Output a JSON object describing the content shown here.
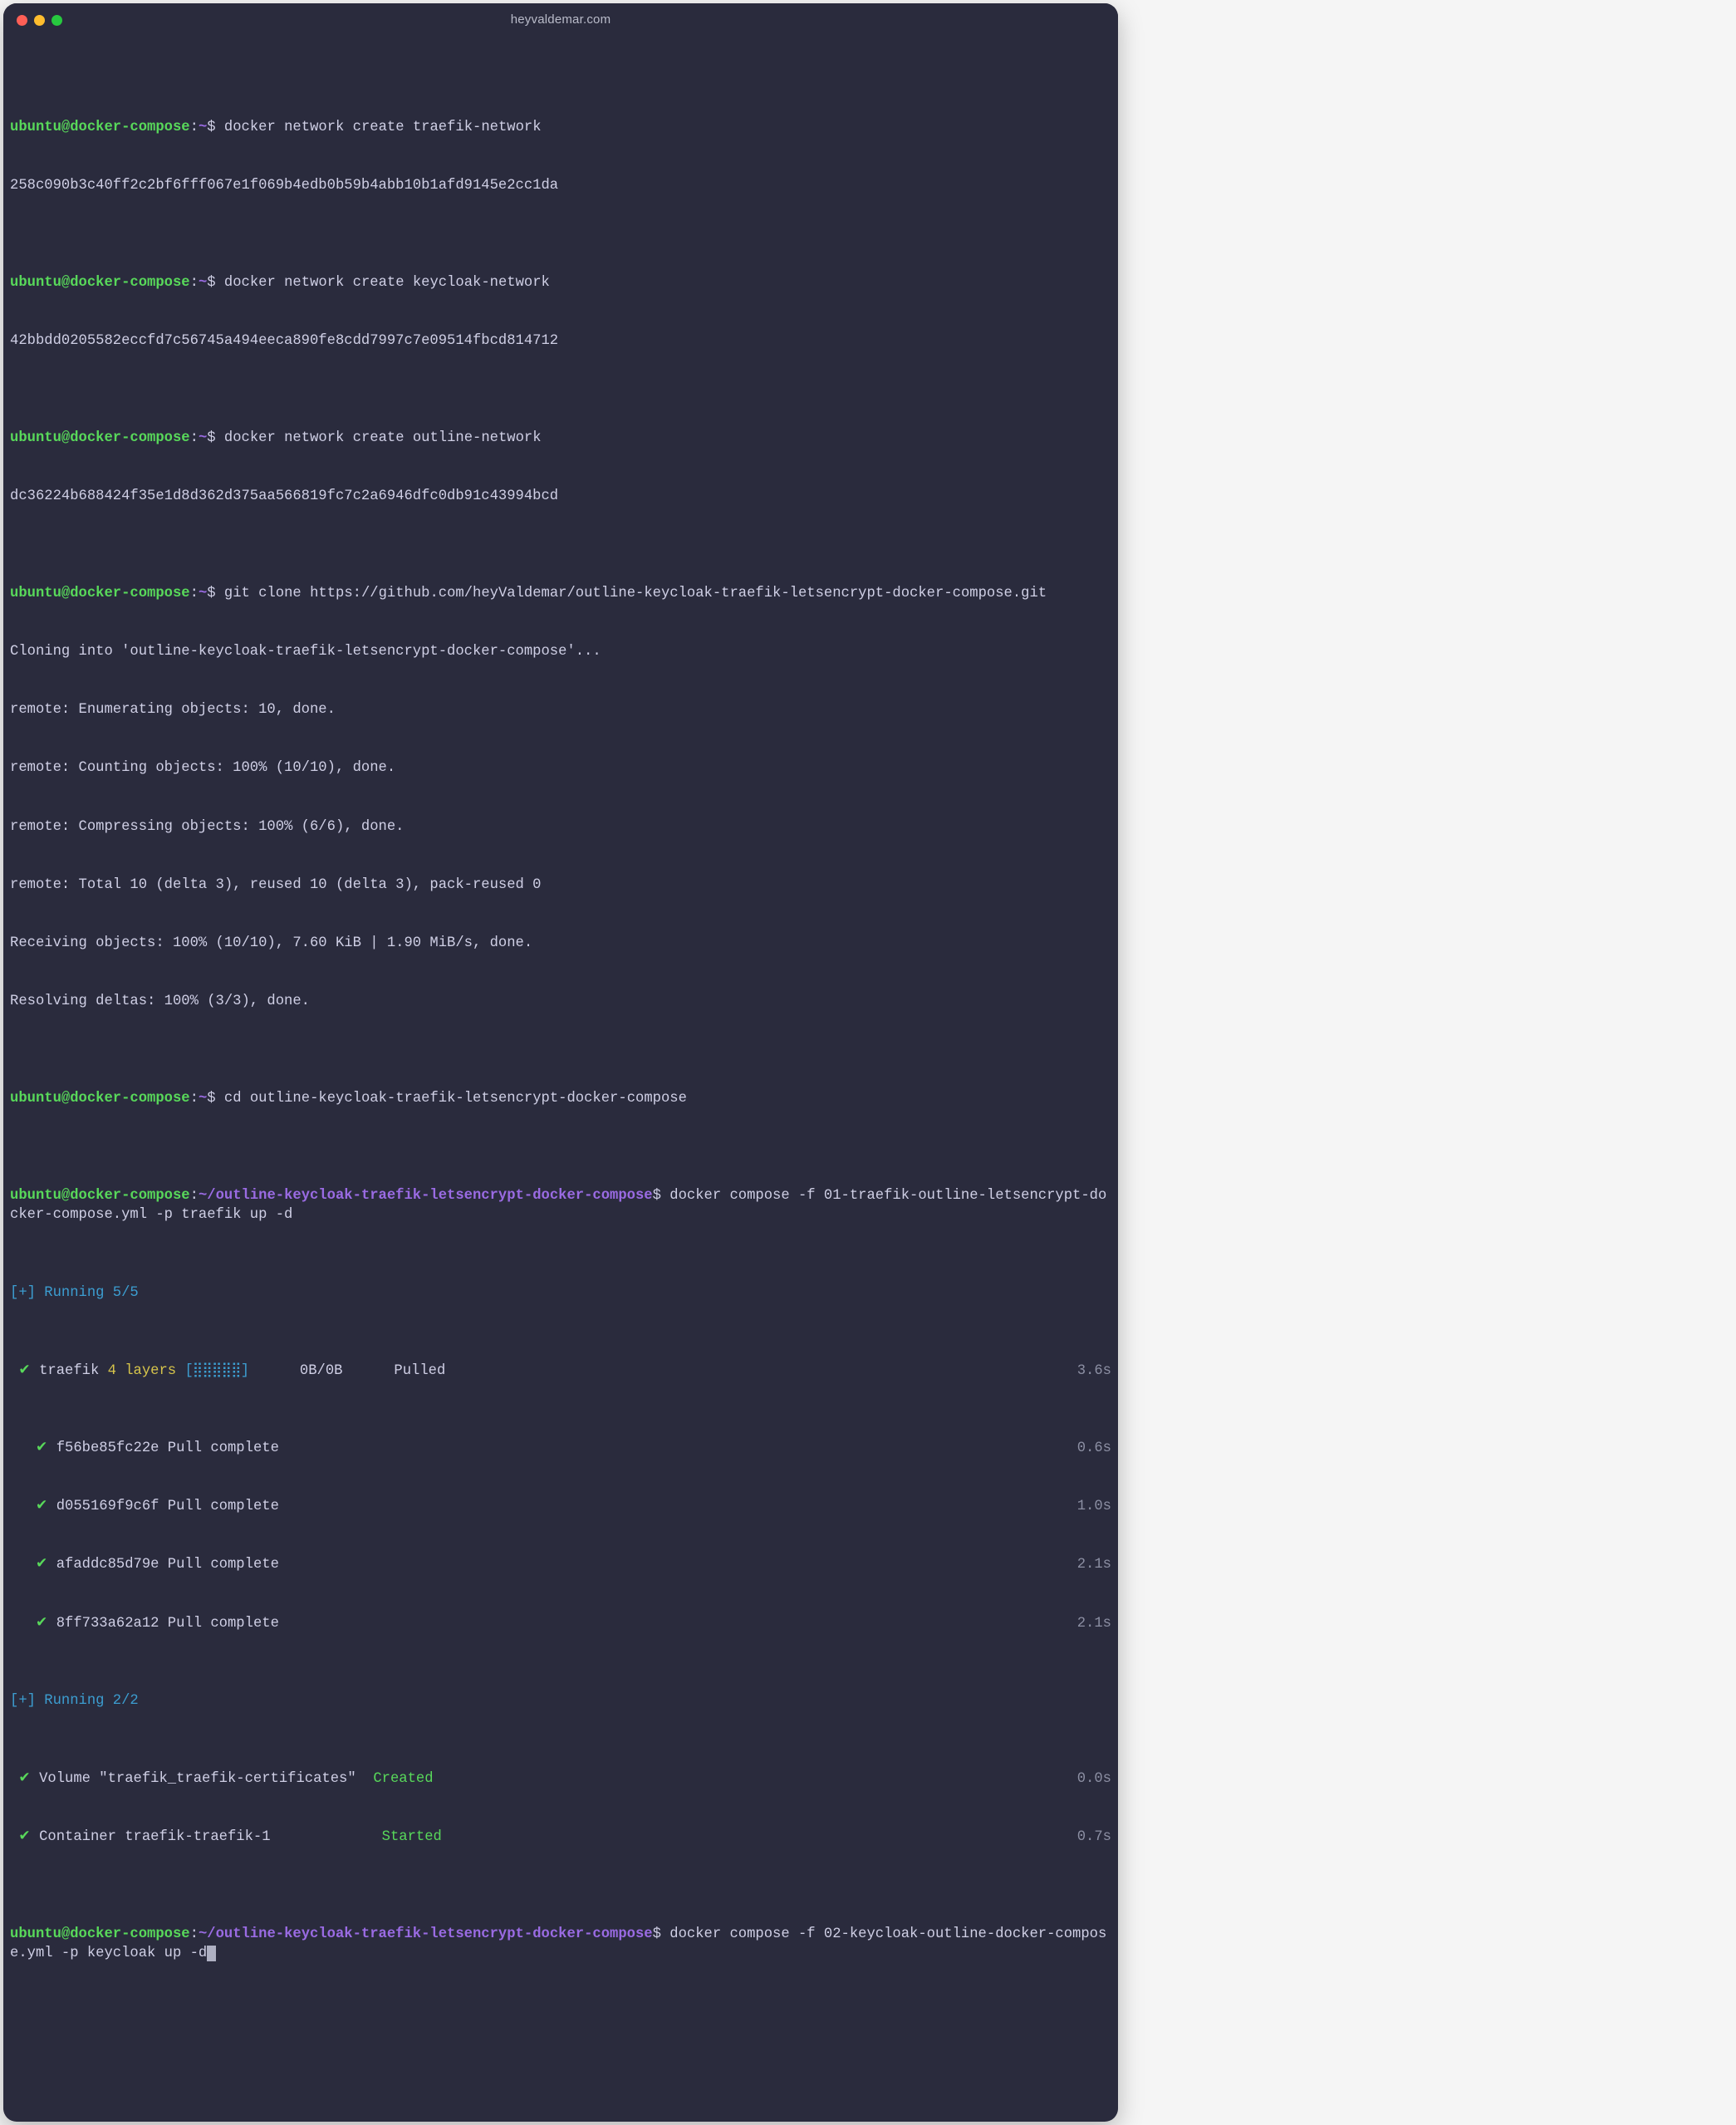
{
  "window": {
    "title": "heyvaldemar.com"
  },
  "colors": {
    "bg": "#2a2b3d",
    "green": "#58d85a",
    "purple": "#9a6be3",
    "teal": "#3c9dd0",
    "yellow": "#d6c44b"
  },
  "prompts": {
    "user": "ubuntu@docker-compose",
    "home": "~",
    "dir": "~/outline-keycloak-traefik-letsencrypt-docker-compose",
    "dollar": "$"
  },
  "cmds": {
    "c1": "docker network create traefik-network",
    "c2": "docker network create keycloak-network",
    "c3": "docker network create outline-network",
    "c4": "git clone https://github.com/heyValdemar/outline-keycloak-traefik-letsencrypt-docker-compose.git",
    "c5": "cd outline-keycloak-traefik-letsencrypt-docker-compose",
    "c6": "docker compose -f 01-traefik-outline-letsencrypt-docker-compose.yml -p traefik up -d",
    "c7": "docker compose -f 02-keycloak-outline-docker-compose.yml -p keycloak up -d"
  },
  "out": {
    "net1": "258c090b3c40ff2c2bf6fff067e1f069b4edb0b59b4abb10b1afd9145e2cc1da",
    "net2": "42bbdd0205582eccfd7c56745a494eeca890fe8cdd7997c7e09514fbcd814712",
    "net3": "dc36224b688424f35e1d8d362d375aa566819fc7c2a6946dfc0db91c43994bcd",
    "clone1": "Cloning into 'outline-keycloak-traefik-letsencrypt-docker-compose'...",
    "clone2": "remote: Enumerating objects: 10, done.",
    "clone3": "remote: Counting objects: 100% (10/10), done.",
    "clone4": "remote: Compressing objects: 100% (6/6), done.",
    "clone5": "remote: Total 10 (delta 3), reused 10 (delta 3), pack-reused 0",
    "clone6": "Receiving objects: 100% (10/10), 7.60 KiB | 1.90 MiB/s, done.",
    "clone7": "Resolving deltas: 100% (3/3), done."
  },
  "run1": {
    "header": "[+] Running 5/5",
    "layer_name": "traefik",
    "layer_count": "4 layers",
    "layer_bar": "[⣿⣿⣿⣿⣿]",
    "layer_size": "0B/0B",
    "layer_status": "Pulled",
    "layer_time": "3.6s",
    "pulls": [
      {
        "id": "f56be85fc22e",
        "msg": "Pull complete",
        "time": "0.6s"
      },
      {
        "id": "d055169f9c6f",
        "msg": "Pull complete",
        "time": "1.0s"
      },
      {
        "id": "afaddc85d79e",
        "msg": "Pull complete",
        "time": "2.1s"
      },
      {
        "id": "8ff733a62a12",
        "msg": "Pull complete",
        "time": "2.1s"
      }
    ]
  },
  "run2": {
    "header": "[+] Running 2/2",
    "items": [
      {
        "name": "Volume \"traefik_traefik-certificates\"",
        "status": "Created",
        "time": "0.0s"
      },
      {
        "name": "Container traefik-traefik-1",
        "status": "Started",
        "time": "0.7s"
      }
    ]
  }
}
